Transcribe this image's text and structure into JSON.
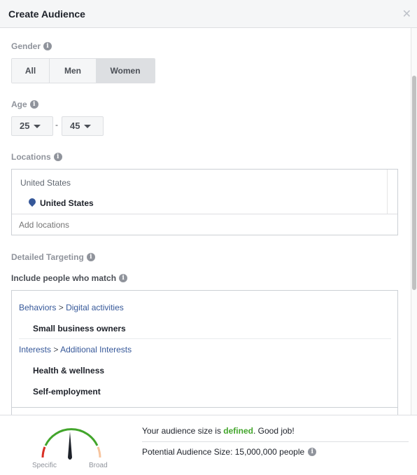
{
  "header": {
    "title": "Create Audience",
    "close_icon": "close-icon"
  },
  "gender": {
    "label": "Gender",
    "options": [
      "All",
      "Men",
      "Women"
    ],
    "selected": "Women"
  },
  "age": {
    "label": "Age",
    "min": "25",
    "separator": "-",
    "max": "45"
  },
  "locations": {
    "label": "Locations",
    "group": "United States",
    "selected": "United States",
    "placeholder": "Add locations"
  },
  "targeting": {
    "label": "Detailed Targeting",
    "include_label": "Include people who match",
    "groups": [
      {
        "category": "Behaviors",
        "separator": ">",
        "subcategory": "Digital activities",
        "items": [
          "Small business owners"
        ]
      },
      {
        "category": "Interests",
        "separator": ">",
        "subcategory": "Additional Interests",
        "items": [
          "Health & wellness",
          "Self-employment"
        ]
      }
    ]
  },
  "footer": {
    "status_prefix": "Your audience size is ",
    "status_word": "defined",
    "status_suffix": ". Good job!",
    "status_color": "#42a52b",
    "potential": "Potential Audience Size: 15,000,000 people",
    "gauge_specific": "Specific",
    "gauge_broad": "Broad",
    "gauge_level": "defined"
  }
}
